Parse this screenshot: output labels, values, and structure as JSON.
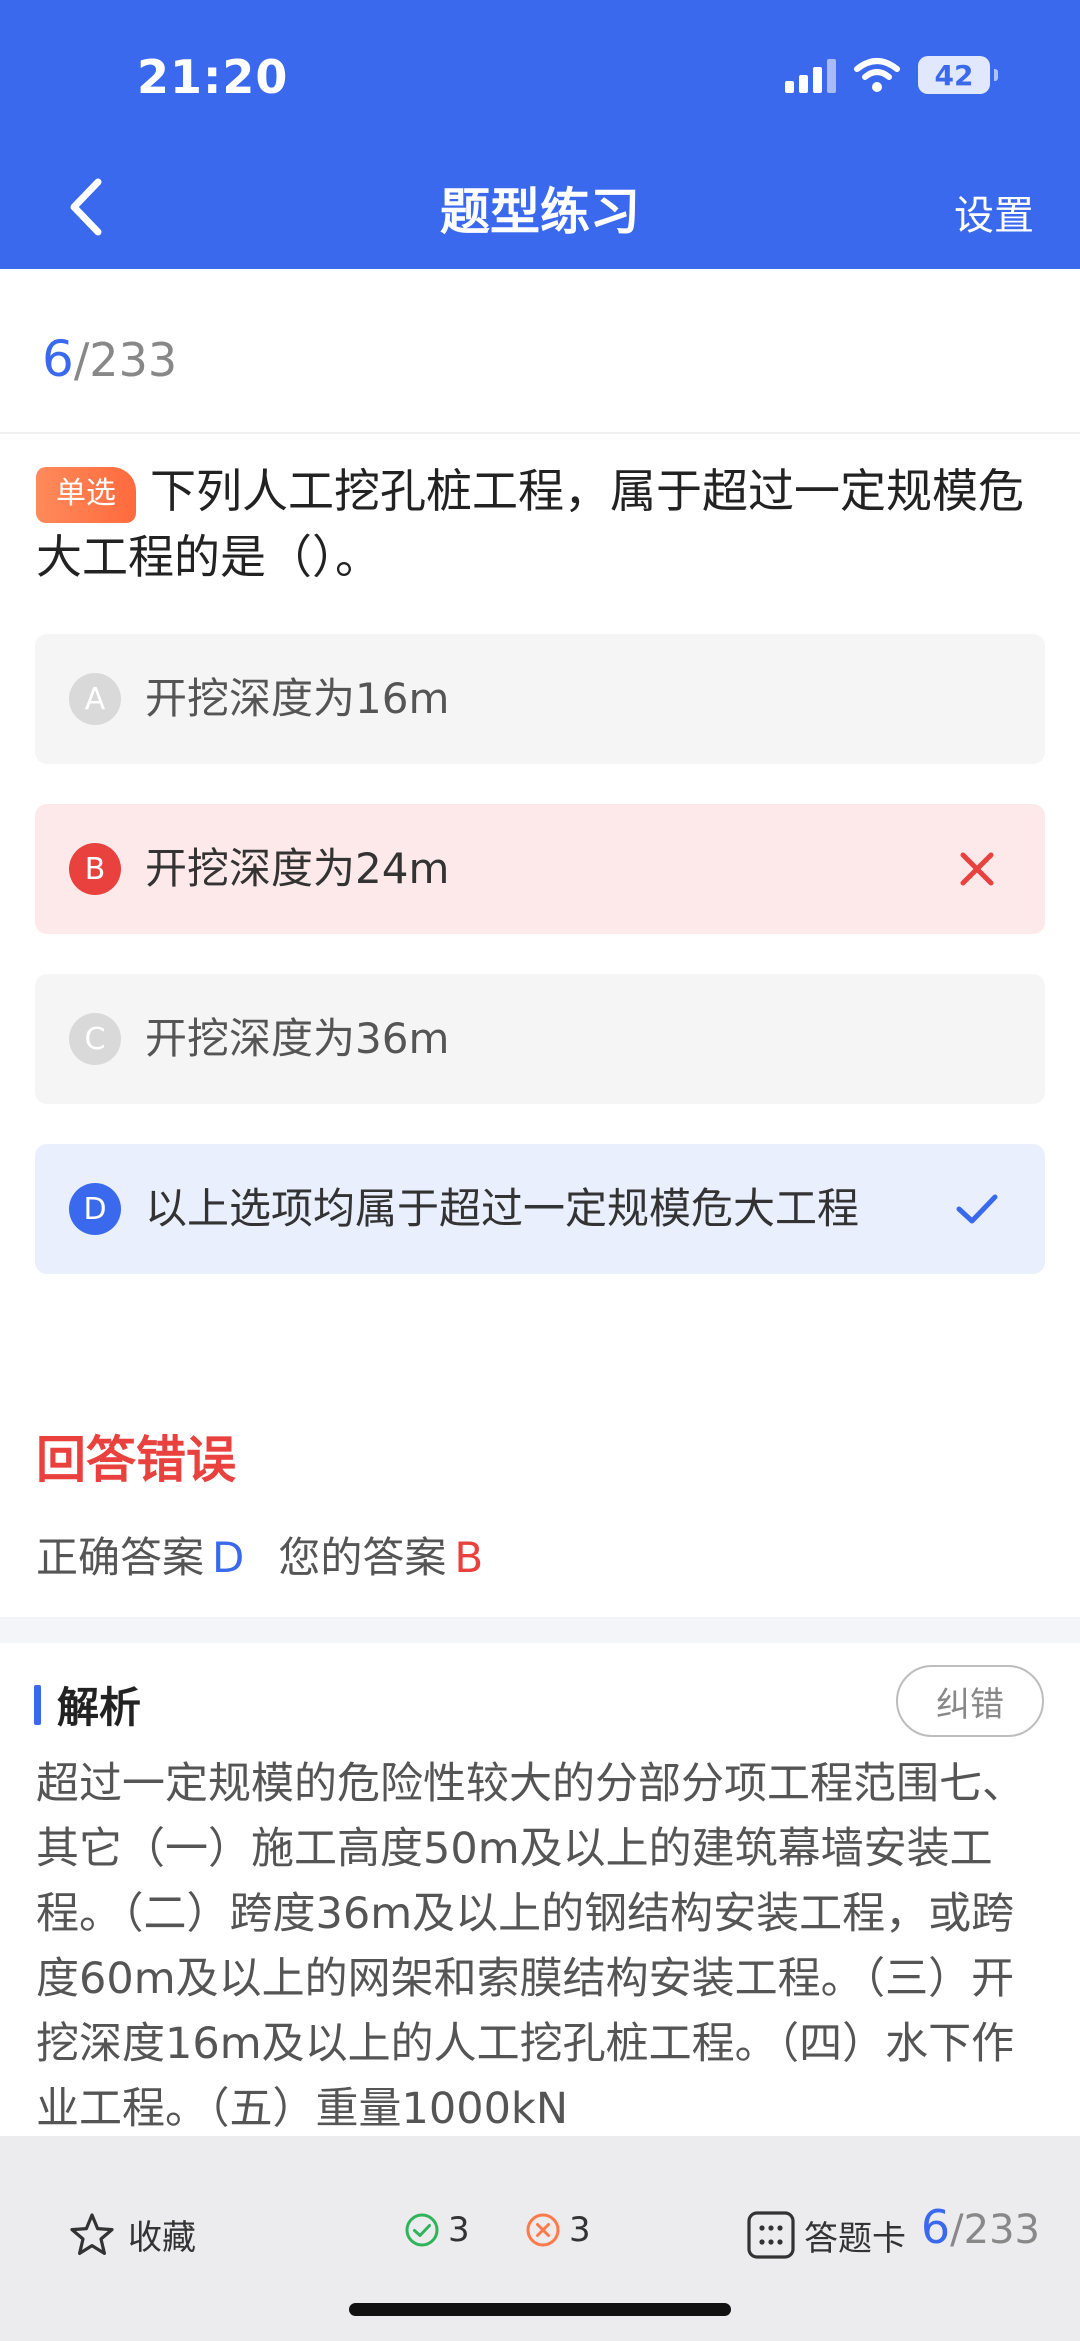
{
  "status_bar": {
    "time": "21:20",
    "battery": "42"
  },
  "nav": {
    "title": "题型练习",
    "settings_label": "设置"
  },
  "progress": {
    "current": "6",
    "total": "/233"
  },
  "question": {
    "type_label": "单选",
    "text": "下列人工挖孔桩工程，属于超过一定规模危大工程的是（）。"
  },
  "options": [
    {
      "letter": "A",
      "text": "开挖深度为16m",
      "state": "normal"
    },
    {
      "letter": "B",
      "text": "开挖深度为24m",
      "state": "wrong"
    },
    {
      "letter": "C",
      "text": "开挖深度为36m",
      "state": "normal"
    },
    {
      "letter": "D",
      "text": "以上选项均属于超过一定规模危大工程",
      "state": "correct"
    }
  ],
  "result": {
    "title": "回答错误",
    "correct_label": "正确答案",
    "correct_value": "D",
    "yours_label": "您的答案",
    "yours_value": "B"
  },
  "analysis": {
    "title": "解析",
    "report_label": "纠错",
    "text": "超过一定规模的危险性较大的分部分项工程范围七、其它（一）施工高度50m及以上的建筑幕墙安装工程。（二）跨度36m及以上的钢结构安装工程，或跨度60m及以上的网架和索膜结构安装工程。（三）开挖深度16m及以上的人工挖孔桩工程。（四）水下作业工程。（五）重量1000kN"
  },
  "bottom_bar": {
    "favorite_label": "收藏",
    "correct_count": "3",
    "wrong_count": "3",
    "answer_card_label": "答题卡",
    "current": "6",
    "total": "/233"
  },
  "colors": {
    "primary": "#3a69ee",
    "wrong": "#e8413e",
    "correct_icon": "#2fb45a",
    "tag": "#ff7a4a"
  },
  "icons": [
    "back-arrow-icon",
    "signal-icon",
    "wifi-icon",
    "battery-icon",
    "cross-icon",
    "check-icon",
    "star-icon",
    "check-circle-icon",
    "cross-circle-icon",
    "grid-icon"
  ]
}
